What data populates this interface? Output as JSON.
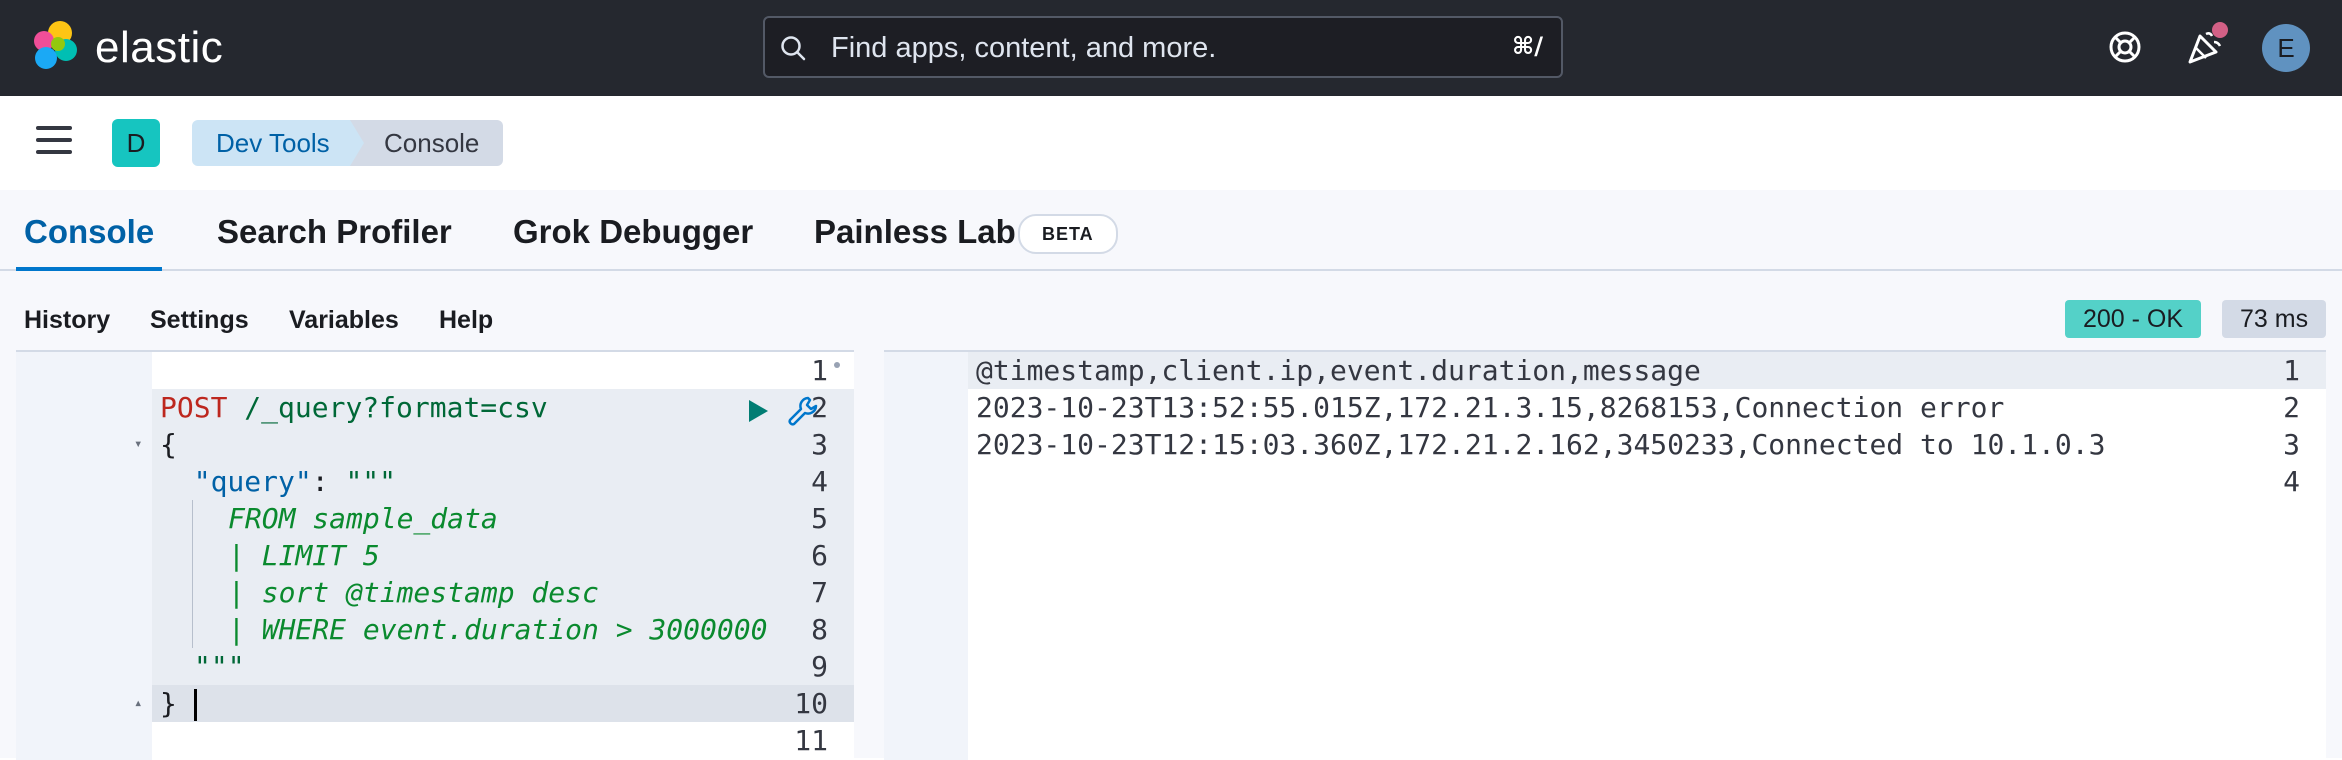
{
  "header": {
    "brand": "elastic",
    "search_placeholder": "Find apps, content, and more.",
    "search_shortcut": "⌘/",
    "avatar_initial": "E"
  },
  "breadcrumbs": {
    "space_initial": "D",
    "items": [
      "Dev Tools",
      "Console"
    ]
  },
  "tabs": [
    {
      "label": "Console",
      "active": true
    },
    {
      "label": "Search Profiler"
    },
    {
      "label": "Grok Debugger"
    },
    {
      "label": "Painless Lab",
      "badge": "BETA"
    }
  ],
  "toolbar": {
    "links": [
      "History",
      "Settings",
      "Variables",
      "Help"
    ],
    "status": "200 - OK",
    "duration": "73 ms"
  },
  "request": {
    "line_numbers": [
      "1",
      "2",
      "3",
      "4",
      "5",
      "6",
      "7",
      "8",
      "9",
      "10",
      "11"
    ],
    "method": "POST",
    "url": " /_query?format=csv",
    "open_brace": "{",
    "query_key": "\"query\"",
    "query_sep": ": ",
    "triple_quote": "\"\"\"",
    "query_lines": [
      "FROM sample_data",
      "| LIMIT 5",
      "| sort @timestamp desc",
      "| WHERE event.duration > 3000000"
    ],
    "close_brace": "}"
  },
  "response": {
    "line_numbers": [
      "1",
      "2",
      "3",
      "4"
    ],
    "lines": [
      "@timestamp,client.ip,event.duration,message",
      "2023-10-23T13:52:55.015Z,172.21.3.15,8268153,Connection error",
      "2023-10-23T12:15:03.360Z,172.21.2.162,3450233,Connected to 10.1.0.3",
      ""
    ]
  },
  "colors": {
    "header_bg": "#25282f",
    "accent": "#0077cc",
    "success": "#54d1c8",
    "space_badge": "#16c5c0",
    "avatar": "#6092c0"
  }
}
